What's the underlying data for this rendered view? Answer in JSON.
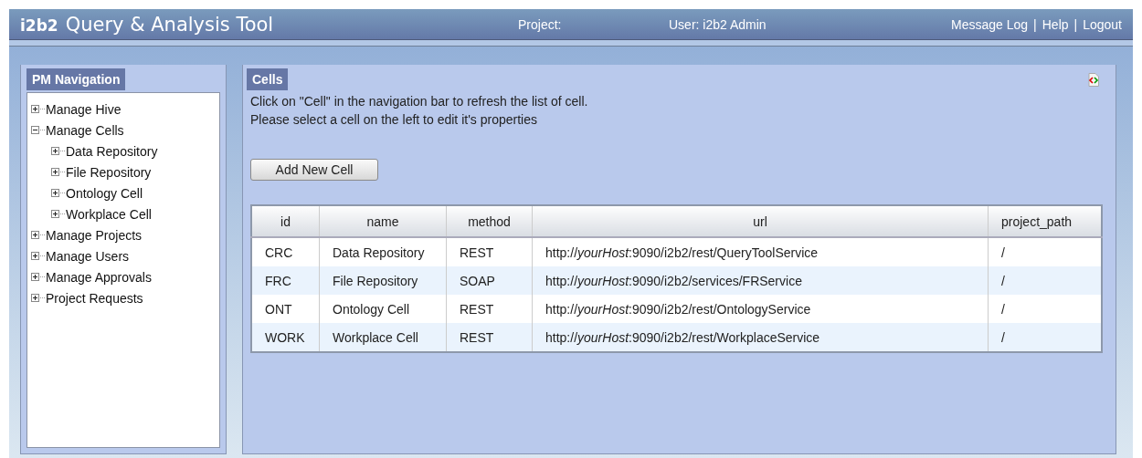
{
  "header": {
    "logo": "i2b2",
    "title": "Query & Analysis Tool",
    "project": "Project:",
    "user": "User: i2b2 Admin",
    "links": [
      "Message Log",
      "Help",
      "Logout"
    ],
    "separators": [
      "|",
      "|"
    ]
  },
  "nav_panel": {
    "tab": "PM Navigation",
    "tree": [
      {
        "label": "Manage Hive",
        "expanded": false
      },
      {
        "label": "Manage Cells",
        "expanded": true,
        "children": [
          {
            "label": "Data Repository",
            "expanded": false
          },
          {
            "label": "File Repository",
            "expanded": false
          },
          {
            "label": "Ontology Cell",
            "expanded": false
          },
          {
            "label": "Workplace Cell",
            "expanded": false
          }
        ]
      },
      {
        "label": "Manage Projects",
        "expanded": false
      },
      {
        "label": "Manage Users",
        "expanded": false
      },
      {
        "label": "Manage Approvals",
        "expanded": false
      },
      {
        "label": "Project Requests",
        "expanded": false
      }
    ]
  },
  "cells_panel": {
    "tab": "Cells",
    "instructions": [
      "Click on \"Cell\" in the navigation bar to refresh the list of cell.",
      "Please select a cell on the left to edit it's properties"
    ],
    "add_button": "Add New Cell",
    "table": {
      "columns": [
        "id",
        "name",
        "method",
        "url",
        "project_path"
      ],
      "rows": [
        [
          "CRC",
          "Data Repository",
          "REST",
          "http://*yourHost*:9090/i2b2/rest/QueryToolService",
          "/"
        ],
        [
          "FRC",
          "File Repository",
          "SOAP",
          "http://*yourHost*:9090/i2b2/services/FRService",
          "/"
        ],
        [
          "ONT",
          "Ontology Cell",
          "REST",
          "http://*yourHost*:9090/i2b2/rest/OntologyService",
          "/"
        ],
        [
          "WORK",
          "Workplace Cell",
          "REST",
          "http://*yourHost*:9090/i2b2/rest/WorkplaceService",
          "/"
        ]
      ]
    }
  }
}
